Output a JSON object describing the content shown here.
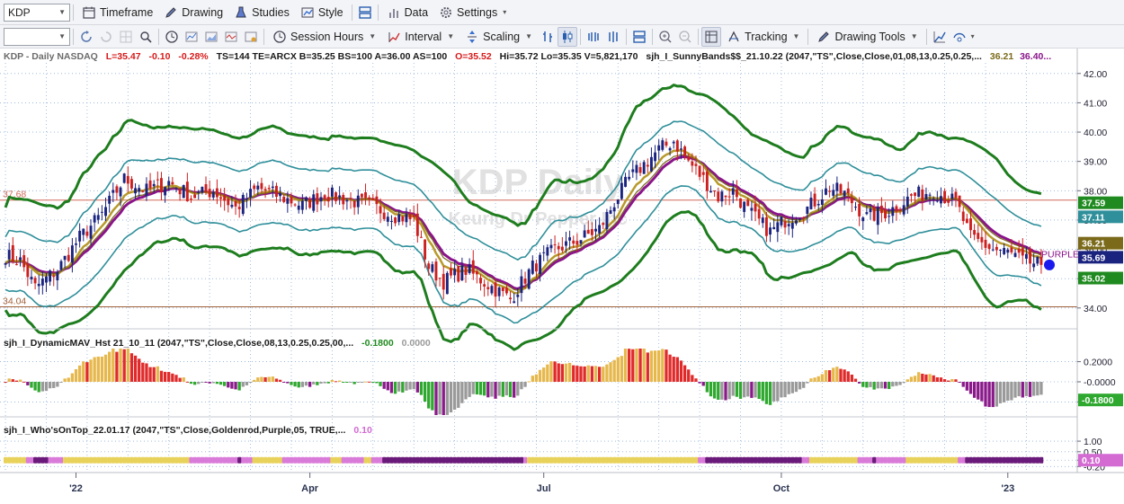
{
  "toolbar1": {
    "symbol": "KDP",
    "timeframe": "Timeframe",
    "drawing": "Drawing",
    "studies": "Studies",
    "style": "Style",
    "data": "Data",
    "settings": "Settings"
  },
  "toolbar2": {
    "session_hours": "Session Hours",
    "interval": "Interval",
    "scaling": "Scaling",
    "tracking": "Tracking",
    "drawing_tools": "Drawing Tools"
  },
  "colors": {
    "bg": "#ffffff",
    "grid": "#8fb0d8",
    "up": "#1a237e",
    "down": "#cc1f1f",
    "band_outer": "#1e7d1e",
    "band_inner": "#2f8f9a",
    "purple": "#8a148a",
    "goldenrod": "#b89a2a",
    "olive": "#7a6a1a",
    "hline_red": "#d06a5a",
    "hline_brown": "#a0603a",
    "hist_gold": "#e6b84c",
    "hist_red": "#e02a2a",
    "hist_gray": "#9a9a9a",
    "hist_green": "#2fa82f",
    "hist_purple": "#8a1a8a",
    "dot_blue": "#1a1aee",
    "axis_text": "#223"
  },
  "main_header": {
    "symbol_info": "KDP - Daily  NASDAQ",
    "last": "L=35.47",
    "change": "-0.10",
    "pct": "-0.28%",
    "rest": "TS=144  TE=ARCX  B=35.25  BS=100  A=36.00  AS=100",
    "open": "O=35.52",
    "ohlc_rest": "Hi=35.72  Lo=35.35  V=5,821,170",
    "study": "sjh_I_SunnyBands$$_21.10.22 (2047,\"TS\",Close,Close,01,08,13,0.25,0.25,...",
    "val1": "36.21",
    "val2": "36.40..."
  },
  "watermark": {
    "title": "KDP Daily",
    "subtitle": "Keurig Dr Pepper Inc"
  },
  "main_scale": {
    "labels": [
      "42.00",
      "41.00",
      "40.00",
      "39.00",
      "38.00",
      "37.00",
      "36.00",
      "35.00",
      "34.00"
    ],
    "values": [
      42,
      41,
      40,
      39,
      38,
      37,
      36,
      35,
      34
    ],
    "min": 33.35,
    "max": 42.3
  },
  "hlines": [
    {
      "value": 37.68,
      "label": "37.68",
      "color_key": "hline_red"
    },
    {
      "value": 34.04,
      "label": "34.04",
      "color_key": "hline_brown"
    }
  ],
  "right_badges": [
    {
      "label": "37.59",
      "color": "#1f8a1f",
      "value": 37.59
    },
    {
      "label": "37.11",
      "color": "#2f8f9a",
      "value": 37.11
    },
    {
      "label": "36.21",
      "color": "#7a6a1a",
      "value": 36.21
    },
    {
      "label": "35.69",
      "color": "#1a237e",
      "value": 35.73
    },
    {
      "label": "35.02",
      "color": "#1f8a1f",
      "value": 35.02
    }
  ],
  "purple_label": "PURPLE",
  "osc_header": {
    "study": "sjh_I_DynamicMAV_Hst 21_10_11 (2047,\"TS\",Close,Close,08,13,0.25,0.25,00,...",
    "val1": "-0.1800",
    "val2": "0.0000"
  },
  "osc_scale": {
    "labels": [
      "0.2000",
      "-0.0000",
      "-0.2000"
    ],
    "values": [
      0.2,
      0.0,
      -0.2
    ],
    "min": -0.33,
    "max": 0.33,
    "badge": "-0.1800",
    "badge_value": -0.18
  },
  "who_header": {
    "study": "sjh_I_Who'sOnTop_22.01.17 (2047,\"TS\",Close,Goldenrod,Purple,05, TRUE,...",
    "val1": "0.10"
  },
  "who_scale": {
    "labels": [
      "1.00",
      "0.50",
      "0.10",
      "-0.20"
    ],
    "values": [
      1.0,
      0.5,
      0.1,
      -0.2
    ],
    "min": -0.4,
    "max": 1.3,
    "badge": "0.10",
    "badge_value": 0.1
  },
  "date_axis": {
    "labels": [
      "'22",
      "Apr",
      "Jul",
      "Oct",
      "'23"
    ],
    "bar_index": [
      19,
      82,
      145,
      209,
      270
    ]
  },
  "price_series": {
    "bars": 280,
    "close_keypoints": [
      [
        0,
        35.8
      ],
      [
        4,
        35.6
      ],
      [
        8,
        34.7
      ],
      [
        14,
        35.3
      ],
      [
        20,
        36.4
      ],
      [
        26,
        37.2
      ],
      [
        32,
        38.4
      ],
      [
        38,
        38.0
      ],
      [
        44,
        38.3
      ],
      [
        50,
        37.8
      ],
      [
        56,
        38.0
      ],
      [
        62,
        37.4
      ],
      [
        68,
        38.1
      ],
      [
        74,
        37.8
      ],
      [
        80,
        37.5
      ],
      [
        86,
        37.9
      ],
      [
        92,
        37.7
      ],
      [
        98,
        37.5
      ],
      [
        104,
        37.2
      ],
      [
        110,
        37.0
      ],
      [
        114,
        35.4
      ],
      [
        118,
        34.9
      ],
      [
        124,
        35.3
      ],
      [
        130,
        34.8
      ],
      [
        136,
        34.3
      ],
      [
        142,
        35.4
      ],
      [
        148,
        36.0
      ],
      [
        154,
        36.3
      ],
      [
        160,
        36.7
      ],
      [
        164,
        37.6
      ],
      [
        168,
        38.4
      ],
      [
        172,
        38.9
      ],
      [
        176,
        39.4
      ],
      [
        180,
        39.7
      ],
      [
        184,
        39.0
      ],
      [
        188,
        38.4
      ],
      [
        192,
        37.8
      ],
      [
        196,
        38.0
      ],
      [
        200,
        37.3
      ],
      [
        206,
        36.6
      ],
      [
        210,
        37.0
      ],
      [
        216,
        37.4
      ],
      [
        222,
        38.1
      ],
      [
        226,
        37.9
      ],
      [
        232,
        37.1
      ],
      [
        238,
        37.3
      ],
      [
        244,
        37.8
      ],
      [
        250,
        38.0
      ],
      [
        256,
        37.6
      ],
      [
        260,
        36.4
      ],
      [
        266,
        36.0
      ],
      [
        270,
        35.9
      ],
      [
        274,
        35.6
      ],
      [
        279,
        35.47
      ]
    ]
  }
}
